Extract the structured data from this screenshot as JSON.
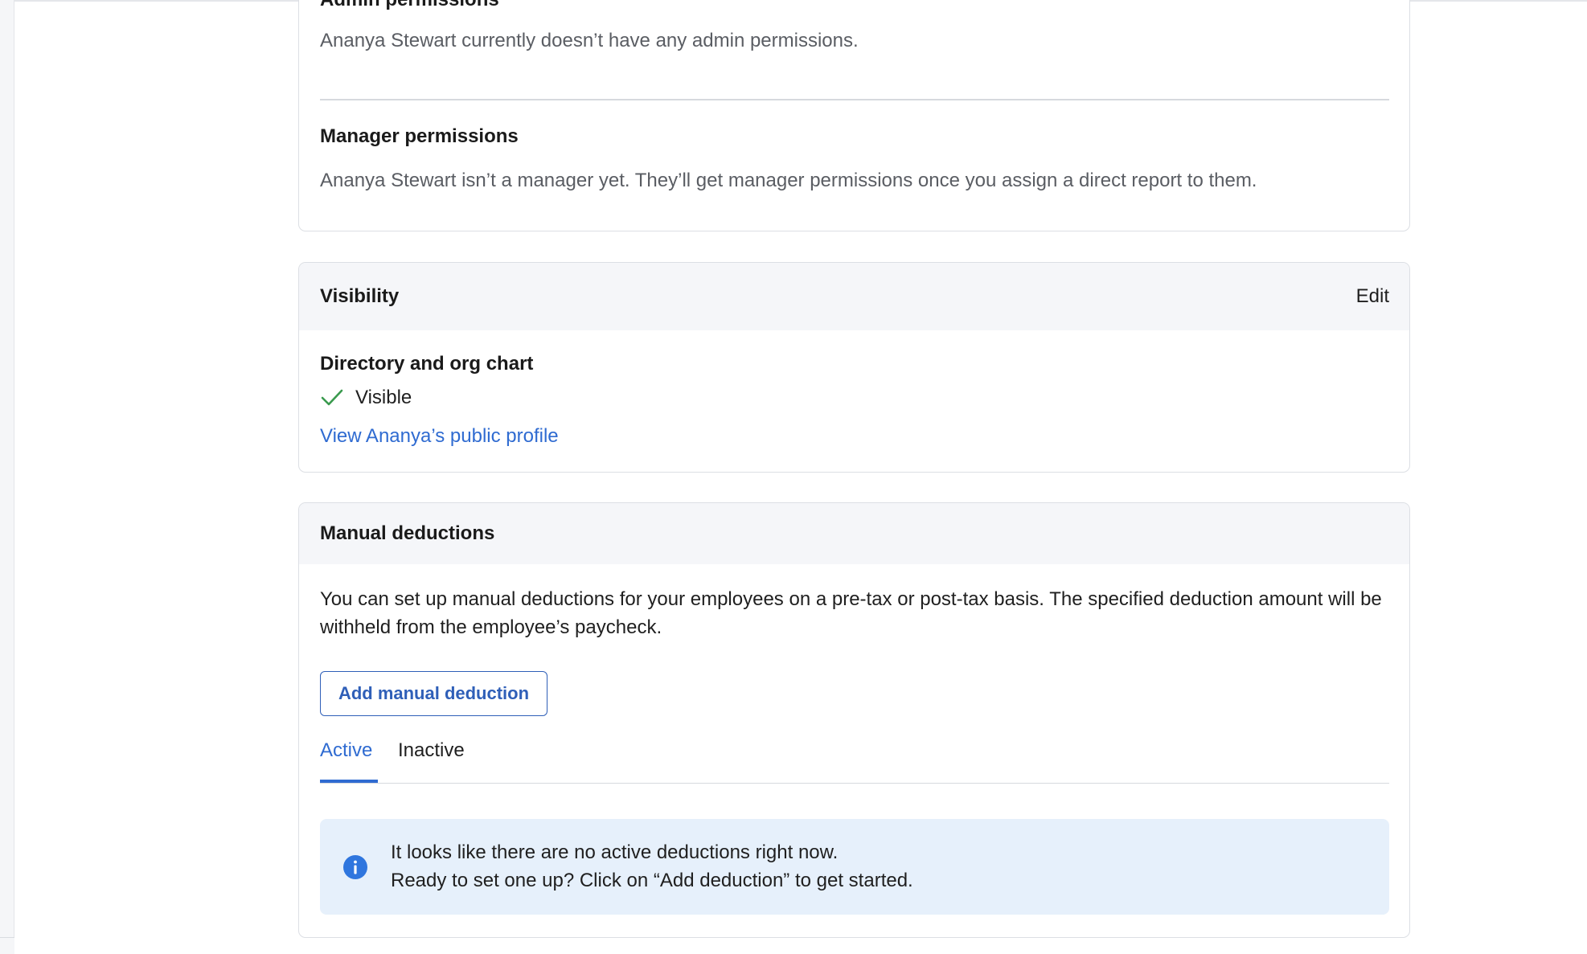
{
  "permissions": {
    "admin_title": "Admin permissions",
    "admin_text": "Ananya Stewart currently doesn’t have any admin permissions.",
    "manager_title": "Manager permissions",
    "manager_text": "Ananya Stewart isn’t a manager yet. They’ll get manager permissions once you assign a direct report to them."
  },
  "visibility": {
    "title": "Visibility",
    "edit_label": "Edit",
    "subtitle": "Directory and org chart",
    "status_icon": "check-icon",
    "status_text": "Visible",
    "status_color": "#3a9a4e",
    "profile_link": "View Ananya’s public profile"
  },
  "deductions": {
    "title": "Manual deductions",
    "description": "You can set up manual deductions for your employees on a pre-tax or post-tax basis. The specified deduction amount will be withheld from the employee’s paycheck.",
    "add_button_label": "Add manual deduction",
    "tabs": [
      {
        "label": "Active",
        "selected": true
      },
      {
        "label": "Inactive",
        "selected": false
      }
    ],
    "info_icon": "info-icon",
    "info_lines": [
      "It looks like there are no active deductions right now.",
      "Ready to set one up? Click on “Add deduction” to get started."
    ]
  },
  "colors": {
    "accent": "#2f6bd1",
    "info_background": "#e6f0fb",
    "header_background": "#f5f6f9",
    "border": "#dcdfe4"
  }
}
